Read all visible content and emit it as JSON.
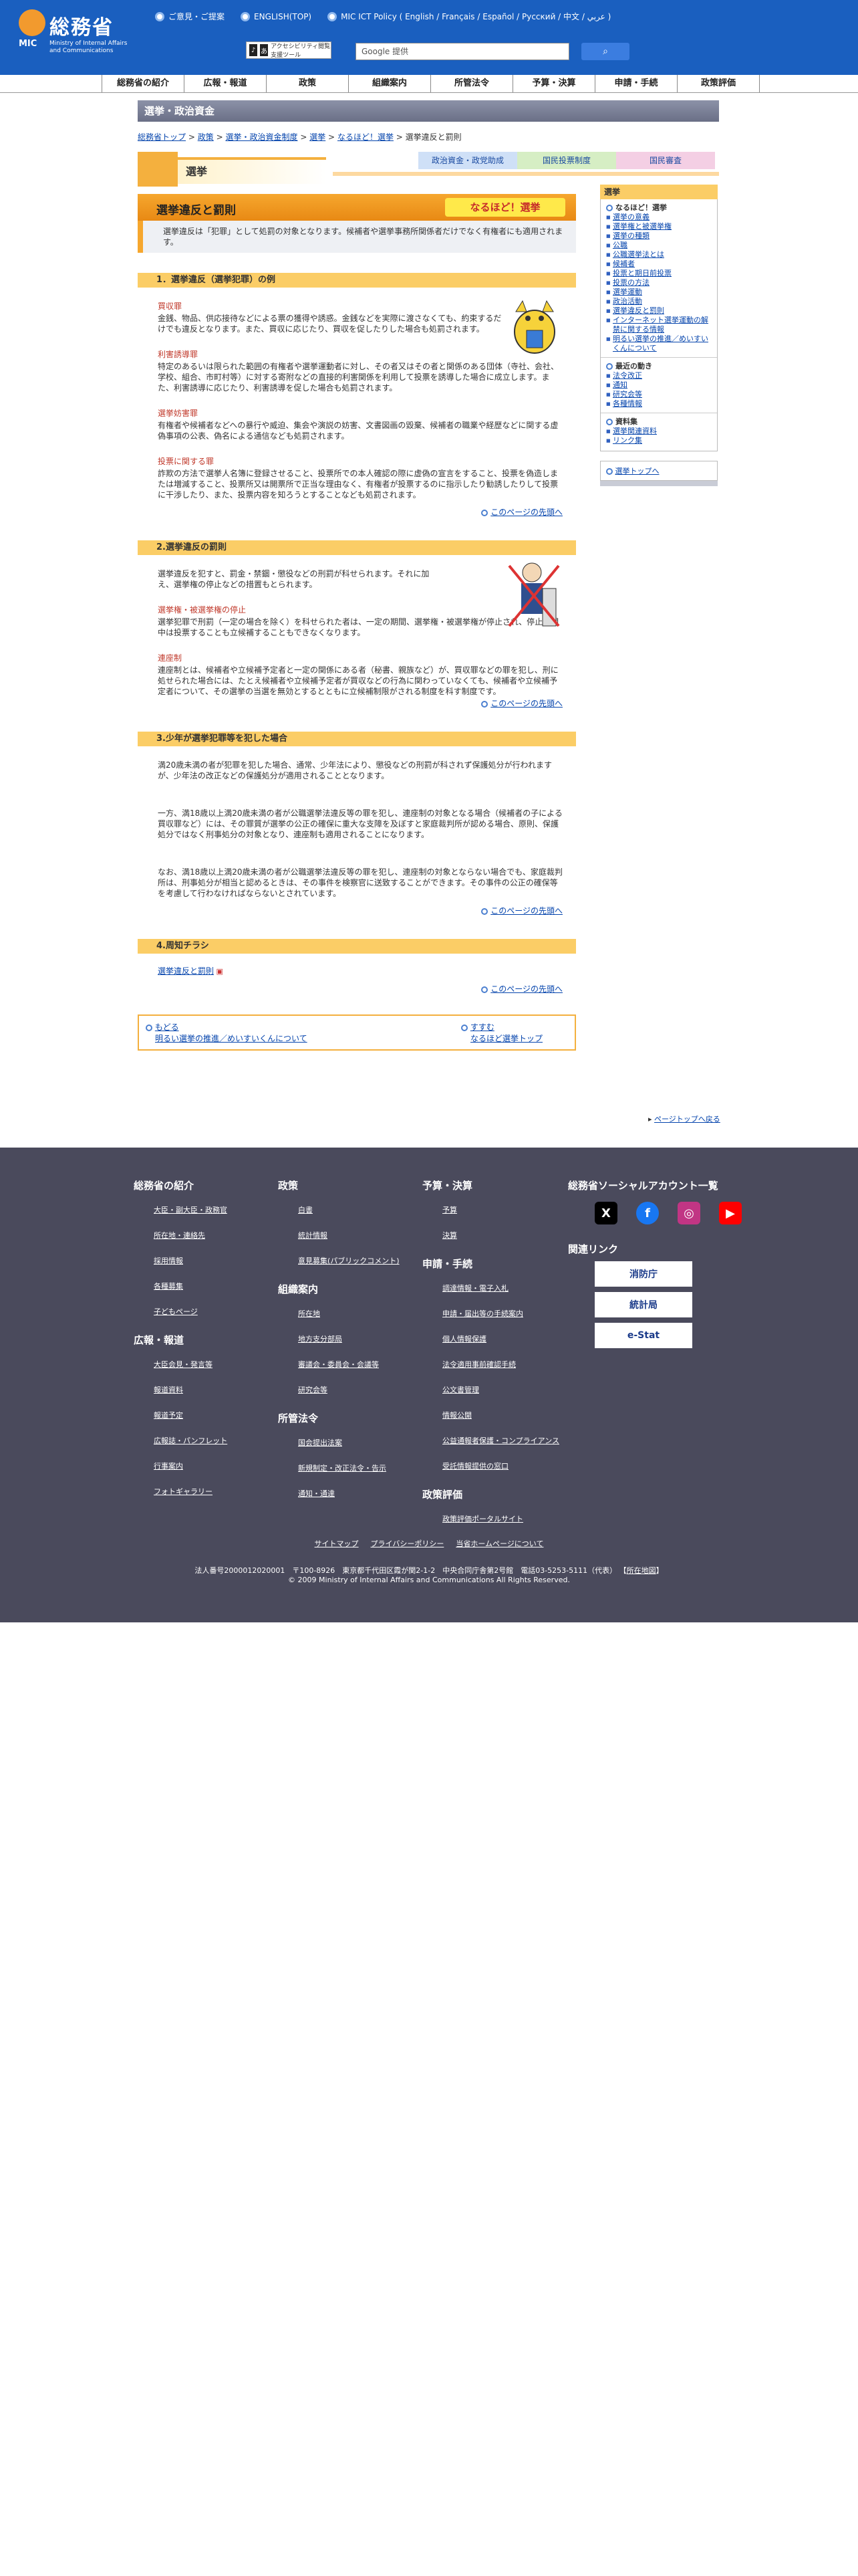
{
  "header": {
    "logo_name": "総務省",
    "logo_mic": "MIC",
    "logo_sub": "Ministry of Internal Affairs and Communications",
    "links": [
      "ご意見・ご提案",
      "ENGLISH(TOP)",
      "MIC ICT Policy ( English / Français / Español / Русский / 中文 / عربي )"
    ],
    "tools_label": "アクセシビリティ閲覧支援ツール",
    "search_placeholder": "Google 提供",
    "search_button": "検索"
  },
  "nav": [
    "総務省の紹介",
    "広報・報道",
    "政策",
    "組織案内",
    "所管法令",
    "予算・決算",
    "申請・手続",
    "政策評価"
  ],
  "page_band": "選挙・政治資金",
  "breadcrumb": [
    "総務省トップ",
    "政策",
    "選挙・政治資金制度",
    "選挙",
    "なるほど！選挙",
    "選挙違反と罰則"
  ],
  "category": {
    "title": "選挙",
    "tabs": [
      "政治資金・政党助成",
      "国民投票制度",
      "国民審査"
    ]
  },
  "main": {
    "title": "選挙違反と罰則",
    "badge": "なるほど！選挙",
    "intro": "選挙違反は「犯罪」として処罰の対象となります。候補者や選挙事務所関係者だけでなく有権者にも適用されます。",
    "pagetop": "このページの先頭へ",
    "sections": [
      {
        "heading": "1．選挙違反（選挙犯罪）の例",
        "items": [
          {
            "title": "買収罪",
            "text": "金銭、物品、供応接待などによる票の獲得や誘惑。金銭などを実際に渡さなくても、約束するだけでも違反となります。また、買収に応じたり、買収を促したりした場合も処罰されます。"
          },
          {
            "title": "利害誘導罪",
            "text": "特定のあるいは限られた範囲の有権者や選挙運動者に対し、その者又はその者と関係のある団体（寺社、会社、学校、組合、市町村等）に対する寄附などの直接的利害関係を利用して投票を誘導した場合に成立します。また、利害誘導に応じたり、利害誘導を促した場合も処罰されます。"
          },
          {
            "title": "選挙妨害罪",
            "text": "有権者や候補者などへの暴行や威迫、集会や演説の妨害、文書図画の毀棄、候補者の職業や経歴などに関する虚偽事項の公表、偽名による通信なども処罰されます。"
          },
          {
            "title": "投票に関する罪",
            "text": "詐欺の方法で選挙人名簿に登録させること、投票所での本人確認の際に虚偽の宣言をすること、投票を偽造しまたは増減すること、投票所又は開票所で正当な理由なく、有権者が投票するのに指示したり勧誘したりして投票に干渉したり、また、投票内容を知ろうとすることなども処罰されます。"
          }
        ]
      },
      {
        "heading": "2.選挙違反の罰則",
        "lead": "選挙違反を犯すと、罰金・禁錮・懲役などの刑罰が科せられます。それに加え、選挙権の停止などの措置もとられます。",
        "items": [
          {
            "title": "選挙権・被選挙権の停止",
            "text": "選挙犯罪で刑罰（一定の場合を除く）を科せられた者は、一定の期間、選挙権・被選挙権が停止され、停止期間中は投票することも立候補することもできなくなります。"
          },
          {
            "title": "連座制",
            "text": "連座制とは、候補者や立候補予定者と一定の関係にある者（秘書、親族など）が、買収罪などの罪を犯し、刑に処せられた場合には、たとえ候補者や立候補予定者が買収などの行為に関わっていなくても、候補者や立候補予定者について、その選挙の当選を無効とするとともに立候補制限がされる制度を科す制度です。"
          }
        ]
      },
      {
        "heading": "3.少年が選挙犯罪等を犯した場合",
        "paras": [
          "満20歳未満の者が犯罪を犯した場合、通常、少年法により、懲役などの刑罰が科されず保護処分が行われますが、少年法の改正などの保護処分が適用されることとなります。",
          "一方、満18歳以上満20歳未満の者が公職選挙法違反等の罪を犯し、連座制の対象となる場合（候補者の子による買収罪など）には、その罪質が選挙の公正の確保に重大な支障を及ぼすと家庭裁判所が認める場合、原則、保護処分ではなく刑事処分の対象となり、連座制も適用されることになります。",
          "なお、満18歳以上満20歳未満の者が公職選挙法違反等の罪を犯し、連座制の対象とならない場合でも、家庭裁判所は、刑事処分が相当と認めるときは、その事件を検察官に送致することができます。その事件の公正の確保等を考慮して行わなければならないとされています。"
        ]
      },
      {
        "heading": "4.周知チラシ",
        "link": "選挙違反と罰則"
      }
    ],
    "navbox": {
      "back": "もどる",
      "back_link": "明るい選挙の推進／めいすいくんについて",
      "next": "すすむ",
      "next_link": "なるほど選挙トップ"
    }
  },
  "sidebar": {
    "head": "選挙",
    "groups": [
      {
        "title": "なるほど！選挙",
        "items": [
          "選挙の意義",
          "選挙権と被選挙権",
          "選挙の種類",
          "公職",
          "公職選挙法とは",
          "候補者",
          "投票と期日前投票",
          "投票の方法",
          "選挙運動",
          "政治活動",
          "選挙違反と罰則",
          "インターネット選挙運動の解禁に関する情報",
          "明るい選挙の推進／めいすいくんについて"
        ]
      },
      {
        "title": "最近の動き",
        "items": [
          "法令改正",
          "通知",
          "研究会等",
          "各種情報"
        ]
      },
      {
        "title": "資料集",
        "items": [
          "選挙関連資料",
          "リンク集"
        ]
      }
    ],
    "top_link": "選挙トップへ"
  },
  "site_top": "ページトップへ戻る",
  "footer": {
    "columns": [
      {
        "heading": "総務省の紹介",
        "links": [
          "大臣・副大臣・政務官",
          "所在地・連絡先",
          "採用情報",
          "各種募集",
          "子どもページ"
        ]
      },
      {
        "heading": "広報・報道",
        "links": [
          "大臣会見・発言等",
          "報道資料",
          "報道予定",
          "広報誌・パンフレット",
          "行事案内",
          "フォトギャラリー"
        ]
      },
      {
        "heading": "政策",
        "links": [
          "白書",
          "統計情報",
          "意見募集(パブリックコメント)"
        ]
      },
      {
        "heading": "組織案内",
        "links": [
          "所在地",
          "地方支分部局",
          "審議会・委員会・会議等",
          "研究会等"
        ]
      },
      {
        "heading": "所管法令",
        "links": [
          "国会提出法案",
          "新規制定・改正法令・告示",
          "通知・通達"
        ]
      },
      {
        "heading": "予算・決算",
        "links": [
          "予算",
          "決算"
        ]
      },
      {
        "heading": "申請・手続",
        "links": [
          "調達情報・電子入札",
          "申請・届出等の手続案内",
          "個人情報保護",
          "法令適用事前確認手続",
          "公文書管理",
          "情報公開",
          "公益通報者保護・コンプライアンス",
          "受託情報提供の窓口"
        ]
      },
      {
        "heading": "政策評価",
        "links": [
          "政策評価ポータルサイト"
        ]
      }
    ],
    "sns_heading": "総務省ソーシャルアカウント一覧",
    "sns": [
      "X",
      "f",
      "◎",
      "▶"
    ],
    "related_heading": "関連リンク",
    "related": [
      "消防庁",
      "統計局",
      "e-Stat"
    ],
    "bottom_links": [
      "サイトマップ",
      "プライバシーポリシー",
      "当省ホームページについて"
    ],
    "address": "法人番号2000012020001　〒100-8926　東京都千代田区霞が関2-1-2　中央合同庁舎第2号館　電話03-5253-5111（代表）",
    "address_link": "所在地図",
    "copyright": "© 2009 Ministry of Internal Affairs and Communications All Rights Reserved."
  }
}
